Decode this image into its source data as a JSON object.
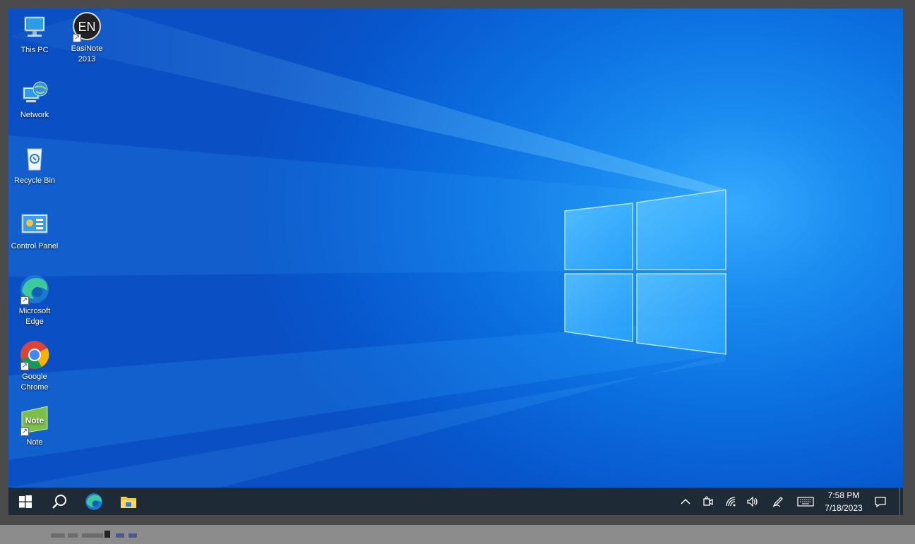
{
  "desktop": {
    "icons": [
      {
        "label": "This PC",
        "icon": "computer-icon"
      },
      {
        "label": "EasiNote\n2013",
        "icon": "easinote-icon",
        "glyph_text": "EN"
      },
      {
        "label": "Network",
        "icon": "network-icon"
      },
      {
        "label": "Recycle Bin",
        "icon": "recycle-bin-icon"
      },
      {
        "label": "Control Panel",
        "icon": "control-panel-icon"
      },
      {
        "label": "Microsoft\nEdge",
        "icon": "edge-icon"
      },
      {
        "label": "Google\nChrome",
        "icon": "chrome-icon"
      },
      {
        "label": "Note",
        "icon": "note-icon",
        "glyph_text": "Note"
      }
    ]
  },
  "taskbar": {
    "pinned": [
      "start-icon",
      "search-icon",
      "edge-icon",
      "file-explorer-icon"
    ],
    "tray": [
      "chevron-up-icon",
      "meet-now-icon",
      "wifi-icon",
      "volume-icon",
      "pen-icon",
      "touch-keyboard-icon"
    ],
    "clock": {
      "time": "7:58 PM",
      "date": "7/18/2023"
    },
    "notifications_icon": "action-center-icon"
  },
  "colors": {
    "taskbar": "#1e2a36",
    "wallpaper_accent": "#0a78d4"
  }
}
